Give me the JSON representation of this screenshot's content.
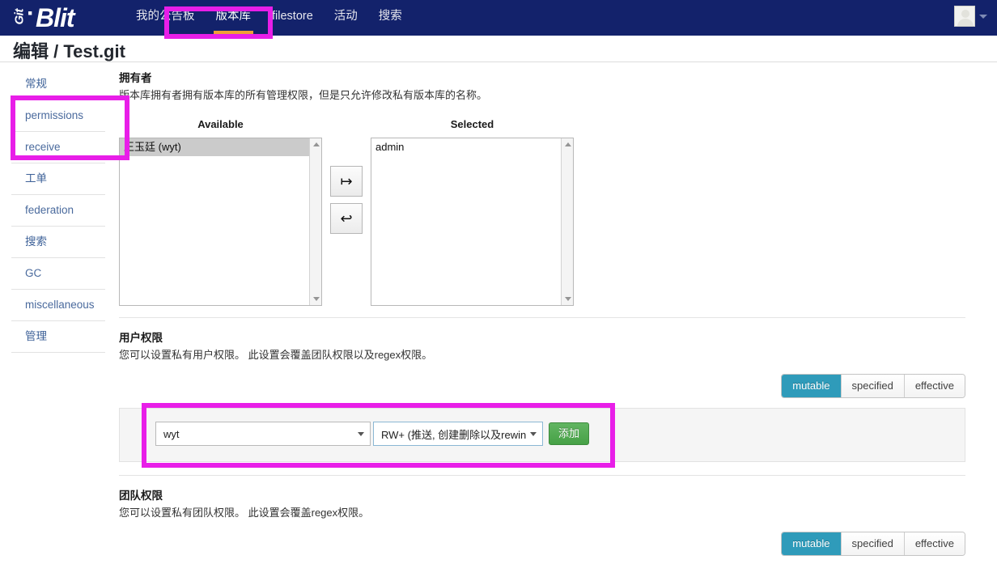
{
  "navbar": {
    "brand": {
      "git": "Git",
      "dot": "·",
      "blit": "Blit"
    },
    "links": [
      {
        "label": "我的公告板",
        "active": false
      },
      {
        "label": "版本库",
        "active": true
      },
      {
        "label": "filestore",
        "active": false
      },
      {
        "label": "活动",
        "active": false
      },
      {
        "label": "搜索",
        "active": false
      }
    ],
    "user_caret": "▾"
  },
  "header": {
    "title": "编辑 / Test.git"
  },
  "sidebar": {
    "items": [
      {
        "label": "常规",
        "name": "general"
      },
      {
        "label": "permissions",
        "name": "permissions"
      },
      {
        "label": "receive",
        "name": "receive"
      },
      {
        "label": "工单",
        "name": "tickets"
      },
      {
        "label": "federation",
        "name": "federation"
      },
      {
        "label": "搜索",
        "name": "search"
      },
      {
        "label": "GC",
        "name": "gc"
      },
      {
        "label": "miscellaneous",
        "name": "miscellaneous"
      },
      {
        "label": "管理",
        "name": "manage"
      }
    ]
  },
  "owner_section": {
    "title": "拥有者",
    "description": "版本库拥有者拥有版本库的所有管理权限，但是只允许修改私有版本库的名称。",
    "available_label": "Available",
    "selected_label": "Selected",
    "available_options": [
      "王玉廷 (wyt)"
    ],
    "selected_options": [
      "admin"
    ],
    "add_button_glyph": "↦",
    "remove_button_glyph": "↩"
  },
  "user_permissions": {
    "title": "用户权限",
    "description": "您可以设置私有用户权限。 此设置会覆盖团队权限以及regex权限。",
    "toggles": [
      {
        "label": "mutable",
        "active": true
      },
      {
        "label": "specified",
        "active": false
      },
      {
        "label": "effective",
        "active": false
      }
    ],
    "user_select_value": "wyt",
    "permission_select_value": "RW+ (推送, 创建删除以及rewin",
    "add_label": "添加"
  },
  "team_permissions": {
    "title": "团队权限",
    "description": "您可以设置私有团队权限。 此设置会覆盖regex权限。",
    "toggles": [
      {
        "label": "mutable",
        "active": true
      },
      {
        "label": "specified",
        "active": false
      },
      {
        "label": "effective",
        "active": false
      }
    ]
  },
  "colors": {
    "navbar": "#13226b",
    "active_tab_underline": "#f0a034",
    "toggle_active": "#2f9bba",
    "add_button": "#46a146",
    "annotation": "#e81ee8"
  }
}
